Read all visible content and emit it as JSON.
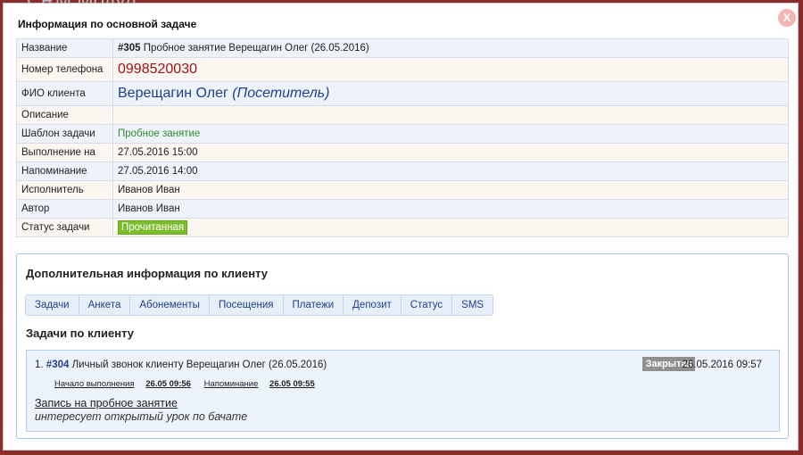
{
  "background_text": "CRM Модул",
  "dialog": {
    "title": "Информация по основной задаче",
    "close_label": "X"
  },
  "info": {
    "rows": [
      {
        "label": "Название",
        "id": "#305",
        "value": " Пробное занятие Верещагин Олег (26.05.2016)"
      },
      {
        "label": "Номер телефона",
        "value": "0998520030"
      },
      {
        "label": "ФИО клиента",
        "name": "Верещагин Олег",
        "role": "(Посетитель)"
      },
      {
        "label": "Описание",
        "value": ""
      },
      {
        "label": "Шаблон задачи",
        "value": "Пробное занятие"
      },
      {
        "label": "Выполнение на",
        "value": "27.05.2016 15:00"
      },
      {
        "label": "Напоминание",
        "value": "27.05.2016 14:00"
      },
      {
        "label": "Исполнитель",
        "value": "Иванов Иван"
      },
      {
        "label": "Автор",
        "value": "Иванов Иван"
      },
      {
        "label": "Статус задачи",
        "value": "Прочитанная"
      }
    ]
  },
  "client_panel": {
    "title": "Дополнительная информация по клиенту",
    "tabs": [
      "Задачи",
      "Анкета",
      "Абонементы",
      "Посещения",
      "Платежи",
      "Депозит",
      "Статус",
      "SMS"
    ],
    "section_title": "Задачи по клиенту",
    "task": {
      "number": "1.",
      "id": "#304",
      "title": " Личный звонок клиенту Верещагин Олег (26.05.2016)",
      "status": "Закрытая",
      "datetime": "26.05.2016 09:57",
      "start_label": "Начало выполнения",
      "start_value": "26.05 09:56",
      "reminder_label": "Напоминание",
      "reminder_value": "26.05 09:55",
      "record_link": "Запись на пробное занятие",
      "note": "интересует открытый урок по бачате"
    }
  },
  "colors": {
    "accent": "#1f3f8f",
    "phone": "#a1131b",
    "status_badge": "#7cbd2b",
    "closed_badge": "#8f8f8f",
    "backdrop": "#8a2c2c"
  }
}
